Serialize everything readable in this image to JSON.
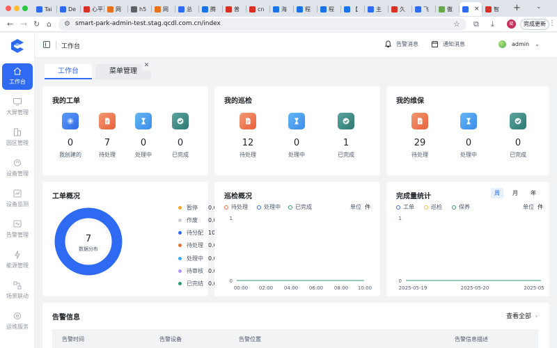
{
  "browser": {
    "tabs": [
      {
        "label": "Tai",
        "favicon_color": "#2f6bf2"
      },
      {
        "label": "De",
        "favicon_color": "#2f6bf2"
      },
      {
        "label": "心平",
        "favicon_color": "#d93025"
      },
      {
        "label": "网",
        "favicon_color": "#e8711c"
      },
      {
        "label": "h5",
        "favicon_color": "#5f6368"
      },
      {
        "label": "网",
        "favicon_color": "#e8711c"
      },
      {
        "label": "总",
        "favicon_color": "#2f6bf2"
      },
      {
        "label": "腾",
        "favicon_color": "#1a73e8"
      },
      {
        "label": "普",
        "favicon_color": "#d93025"
      },
      {
        "label": "cn",
        "favicon_color": "#d93025"
      },
      {
        "label": "海",
        "favicon_color": "#1a73e8"
      },
      {
        "label": "程",
        "favicon_color": "#1a73e8"
      },
      {
        "label": "程",
        "favicon_color": "#1a73e8"
      },
      {
        "label": "【",
        "favicon_color": "#1a73e8"
      },
      {
        "label": "主",
        "favicon_color": "#2f6bf2"
      },
      {
        "label": "久",
        "favicon_color": "#d93025"
      },
      {
        "label": "飞",
        "favicon_color": "#2f6bf2"
      },
      {
        "label": "傲",
        "favicon_color": "#6aa84f"
      },
      {
        "label": "",
        "favicon_color": "#2f6bf2",
        "active": true
      },
      {
        "label": "智",
        "favicon_color": "#d93025"
      }
    ],
    "url": "smart-park-admin-test.stag.qcdl.com.cn/index",
    "update_button": "完成更新",
    "profile_initial": "晓"
  },
  "sidebar": {
    "items": [
      {
        "label": "工作台",
        "icon": "home-icon",
        "active": true
      },
      {
        "label": "大屏管理",
        "icon": "monitor-icon"
      },
      {
        "label": "园区管理",
        "icon": "building-icon"
      },
      {
        "label": "设备管理",
        "icon": "device-icon"
      },
      {
        "label": "设备监测",
        "icon": "monitor-chart-icon"
      },
      {
        "label": "告警管理",
        "icon": "alarm-icon"
      },
      {
        "label": "能源管理",
        "icon": "energy-icon"
      },
      {
        "label": "场景联动",
        "icon": "scene-icon"
      },
      {
        "label": "运维服务",
        "icon": "service-icon"
      }
    ]
  },
  "header": {
    "title": "工作台",
    "alarm_msg": "告警消息",
    "notice_msg": "通知消息",
    "user": "admin"
  },
  "page_tabs": [
    {
      "label": "工作台",
      "active": true
    },
    {
      "label": "菜单管理",
      "active": false
    }
  ],
  "my_workorders": {
    "title": "我的工单",
    "stats": [
      {
        "value": "0",
        "label": "我创建的",
        "color": "#2e6ae8",
        "icon": "plus-icon"
      },
      {
        "value": "7",
        "label": "待处理",
        "color": "#e6603b",
        "icon": "document-icon"
      },
      {
        "value": "0",
        "label": "处理中",
        "color": "#3c8ce8",
        "icon": "hourglass-icon"
      },
      {
        "value": "0",
        "label": "已完成",
        "color": "#2d7a72",
        "icon": "check-icon"
      }
    ]
  },
  "my_inspection": {
    "title": "我的巡检",
    "stats": [
      {
        "value": "12",
        "label": "待处理",
        "color": "#e6603b",
        "icon": "document-icon"
      },
      {
        "value": "0",
        "label": "处理中",
        "color": "#3c8ce8",
        "icon": "hourglass-icon"
      },
      {
        "value": "1",
        "label": "已完成",
        "color": "#2d7a72",
        "icon": "check-icon"
      }
    ]
  },
  "my_maintenance": {
    "title": "我的维保",
    "stats": [
      {
        "value": "29",
        "label": "待处理",
        "color": "#e6603b",
        "icon": "document-icon"
      },
      {
        "value": "0",
        "label": "处理中",
        "color": "#3c8ce8",
        "icon": "hourglass-icon"
      },
      {
        "value": "0",
        "label": "已完成",
        "color": "#2d7a72",
        "icon": "check-icon"
      }
    ]
  },
  "workorder_overview": {
    "title": "工单概况",
    "center_value": "7",
    "center_label": "数据分布",
    "legend": [
      {
        "name": "暂停",
        "pct": "0.00%",
        "color": "#f5a623"
      },
      {
        "name": "作废",
        "pct": "0.00%",
        "color": "#c9cdd4"
      },
      {
        "name": "待分配",
        "pct": "100.00%",
        "color": "#2f6bf2"
      },
      {
        "name": "待处理",
        "pct": "0.00%",
        "color": "#e8713c"
      },
      {
        "name": "处理中",
        "pct": "0.00%",
        "color": "#3da9f5"
      },
      {
        "name": "待审核",
        "pct": "0.00%",
        "color": "#b794f4"
      },
      {
        "name": "已完结",
        "pct": "0.00%",
        "color": "#2d9a6a"
      }
    ]
  },
  "inspection_overview": {
    "title": "巡检概况",
    "unit_label": "单位",
    "unit": "件",
    "legend": [
      {
        "name": "待处理",
        "color": "#e8713c"
      },
      {
        "name": "处理中",
        "color": "#2f6bf2"
      },
      {
        "name": "已完成",
        "color": "#2d9a6a"
      }
    ]
  },
  "completion_stats": {
    "title": "完成量统计",
    "periods": [
      "周",
      "月",
      "年"
    ],
    "active_period": "周",
    "unit_label": "单位",
    "unit": "件",
    "legend": [
      {
        "name": "工单",
        "color": "#2f6bf2"
      },
      {
        "name": "巡检",
        "color": "#f5c542"
      },
      {
        "name": "保养",
        "color": "#2d9a6a"
      }
    ]
  },
  "alarm_info": {
    "title": "告警信息",
    "more": "查看全部",
    "columns": [
      "告警时间",
      "告警设备",
      "告警位置",
      "告警信息描述"
    ]
  },
  "chart_data": [
    {
      "type": "pie",
      "title": "工单概况",
      "categories": [
        "暂停",
        "作废",
        "待分配",
        "待处理",
        "处理中",
        "待审核",
        "已完结"
      ],
      "values": [
        0,
        0,
        7,
        0,
        0,
        0,
        0
      ]
    },
    {
      "type": "line",
      "title": "巡检概况",
      "x": [
        "00:00",
        "02:00",
        "04:00",
        "06:00",
        "08:00",
        "10:00"
      ],
      "ylim": [
        0,
        1
      ],
      "yticks": [
        "0",
        "1"
      ],
      "series": [
        {
          "name": "待处理",
          "values": [
            0,
            0,
            0,
            0,
            0,
            0
          ]
        },
        {
          "name": "处理中",
          "values": [
            0,
            0,
            0,
            0,
            0,
            0
          ]
        },
        {
          "name": "已完成",
          "values": [
            0,
            0,
            0,
            0,
            0,
            0
          ]
        }
      ]
    },
    {
      "type": "line",
      "title": "完成量统计",
      "x": [
        "2025-05-19",
        "2025-05-20",
        "2025-05"
      ],
      "ylim": [
        0,
        1
      ],
      "yticks": [
        "0",
        "1"
      ],
      "series": [
        {
          "name": "工单",
          "values": [
            0,
            0,
            0
          ]
        },
        {
          "name": "巡检",
          "values": [
            0,
            0,
            0
          ]
        },
        {
          "name": "保养",
          "values": [
            0,
            0,
            0
          ]
        }
      ]
    }
  ]
}
